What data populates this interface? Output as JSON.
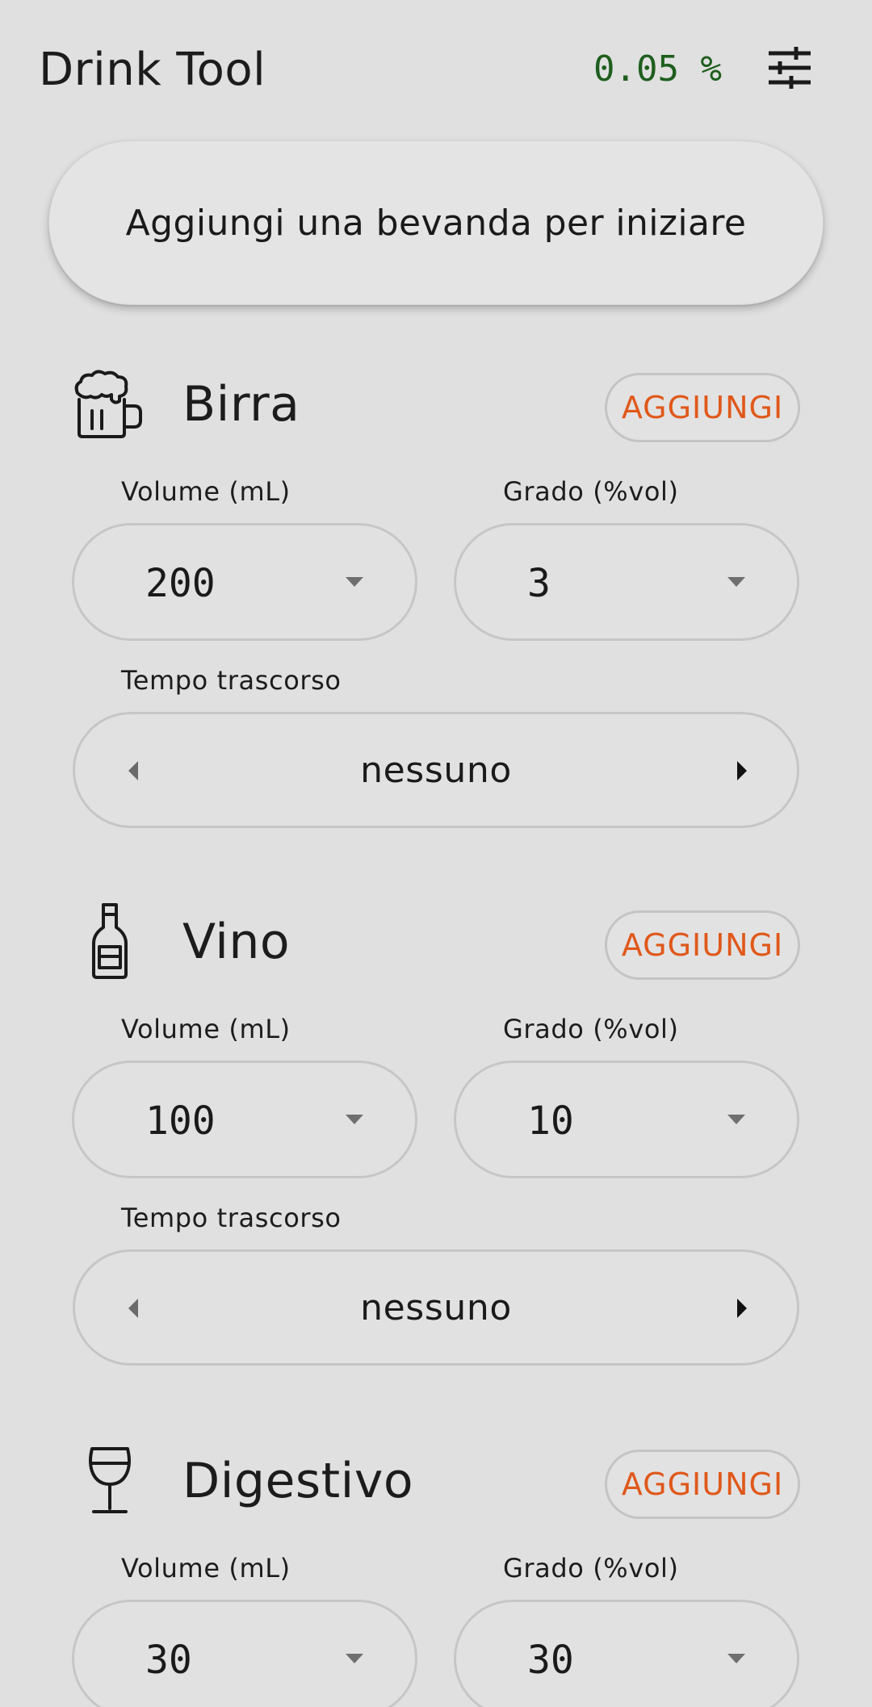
{
  "header": {
    "title": "Drink Tool",
    "bac": "0.05 %",
    "settings_icon": "sliders-icon"
  },
  "status": {
    "message": "Aggiungi una bevanda per iniziare"
  },
  "drinks": [
    {
      "name": "Birra",
      "icon": "beer-mug-icon",
      "add_label": "AGGIUNGI",
      "volume_label": "Volume (mL)",
      "volume": "200",
      "degree_label": "Grado (%vol)",
      "degree": "3",
      "time_label": "Tempo trascorso",
      "time": "nessuno"
    },
    {
      "name": "Vino",
      "icon": "wine-bottle-icon",
      "add_label": "AGGIUNGI",
      "volume_label": "Volume (mL)",
      "volume": "100",
      "degree_label": "Grado (%vol)",
      "degree": "10",
      "time_label": "Tempo trascorso",
      "time": "nessuno"
    },
    {
      "name": "Digestivo",
      "icon": "wine-glass-icon",
      "add_label": "AGGIUNGI",
      "volume_label": "Volume (mL)",
      "volume": "30",
      "degree_label": "Grado (%vol)",
      "degree": "30"
    }
  ],
  "colors": {
    "background": "#e0e0e0",
    "accent": "#e0581a",
    "bac": "#1e5e1e"
  }
}
